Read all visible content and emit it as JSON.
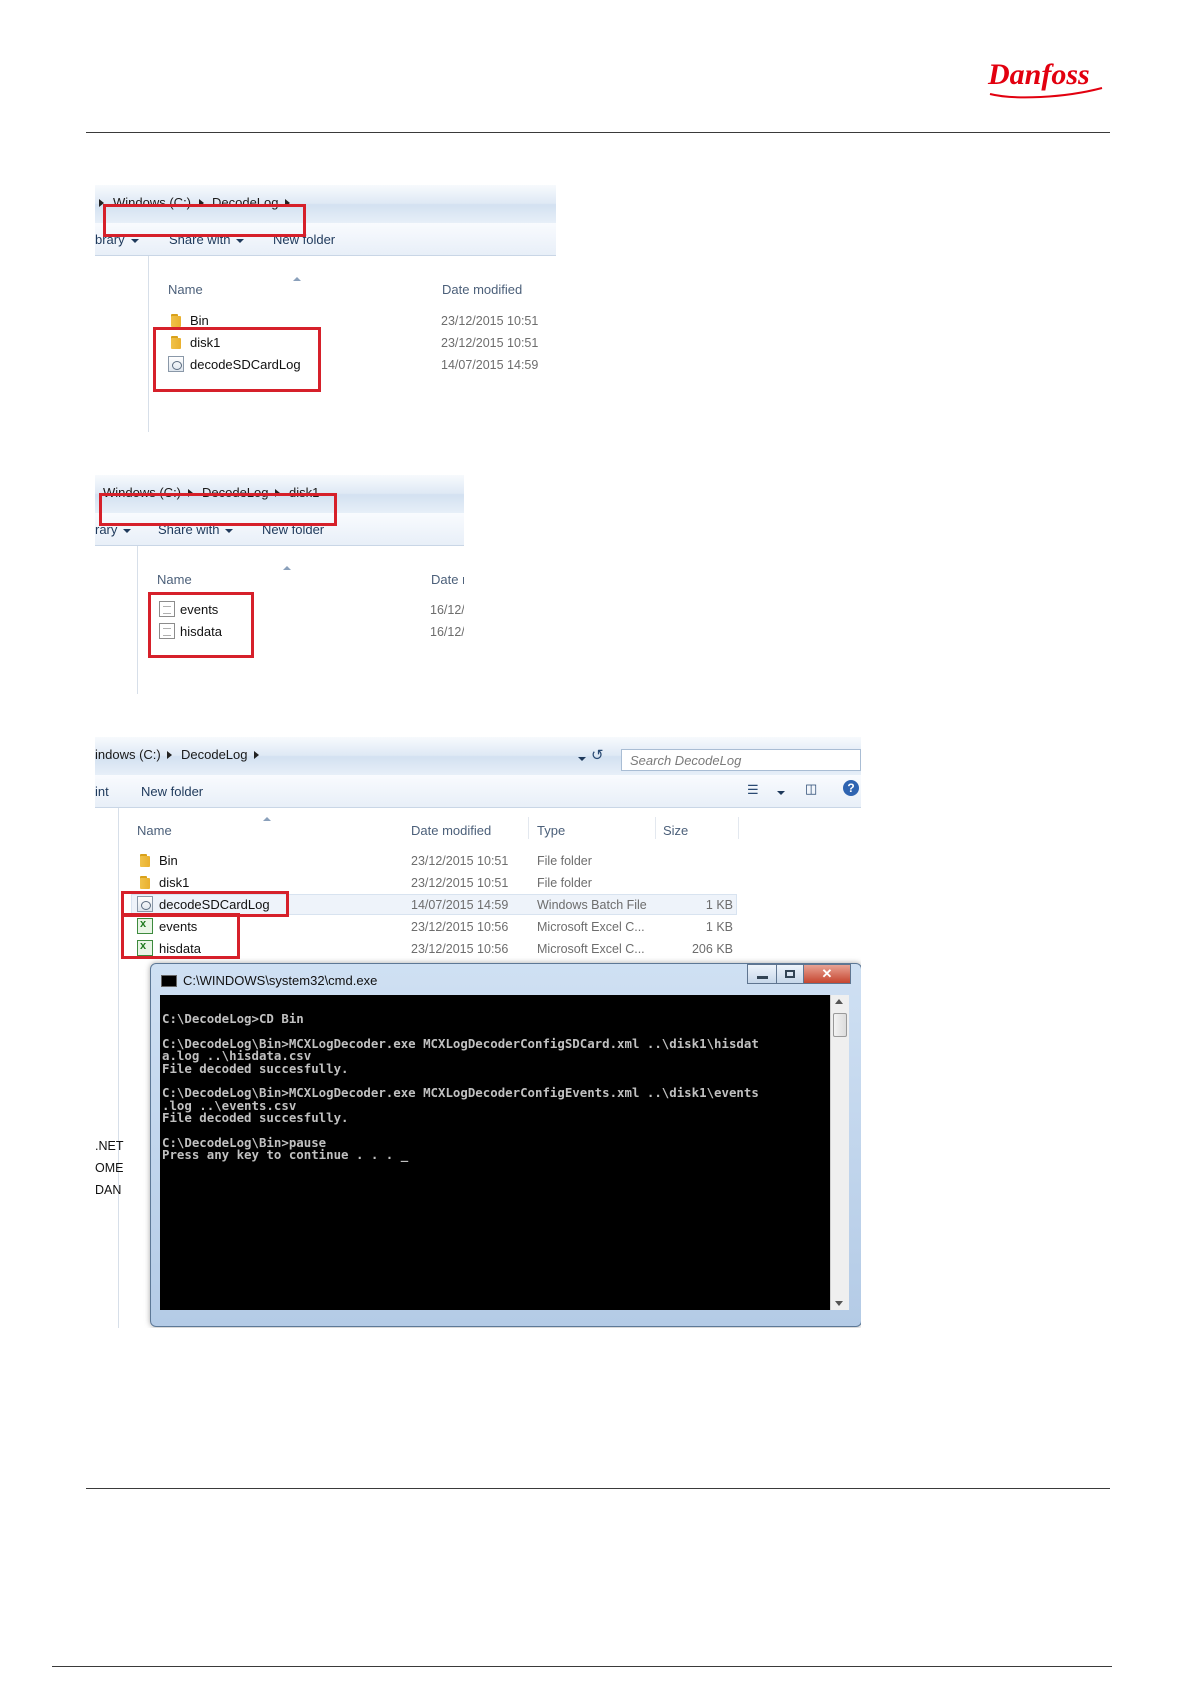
{
  "brand": {
    "logo_text": "Danfoss",
    "color": "#e2000f"
  },
  "screenshot1": {
    "breadcrumb": [
      "Windows (C:)",
      "DecodeLog"
    ],
    "toolbar": {
      "left_clip": "brary",
      "share": "Share with",
      "new_folder": "New folder"
    },
    "columns": {
      "name": "Name",
      "date": "Date modified"
    },
    "files": [
      {
        "name": "Bin",
        "date": "23/12/2015 10:51",
        "icon": "folder-icon"
      },
      {
        "name": "disk1",
        "date": "23/12/2015 10:51",
        "icon": "folder-icon"
      },
      {
        "name": "decodeSDCardLog",
        "date": "14/07/2015 14:59",
        "icon": "batch-file-icon"
      }
    ]
  },
  "screenshot2": {
    "breadcrumb": [
      "Windows (C:)",
      "DecodeLog",
      "disk1"
    ],
    "toolbar": {
      "left_clip": "rary",
      "share": "Share with",
      "new_folder": "New folder"
    },
    "columns": {
      "name": "Name",
      "date": "Date r"
    },
    "files": [
      {
        "name": "events",
        "date": "16/12/",
        "icon": "document-icon"
      },
      {
        "name": "hisdata",
        "date": "16/12/",
        "icon": "document-icon"
      }
    ]
  },
  "screenshot3": {
    "breadcrumb": [
      "indows (C:)",
      "DecodeLog"
    ],
    "search_placeholder": "Search DecodeLog",
    "toolbar": {
      "left_clip": "int",
      "new_folder": "New folder"
    },
    "columns": {
      "name": "Name",
      "date": "Date modified",
      "type": "Type",
      "size": "Size"
    },
    "files": [
      {
        "name": "Bin",
        "date": "23/12/2015 10:51",
        "type": "File folder",
        "size": "",
        "icon": "folder-icon"
      },
      {
        "name": "disk1",
        "date": "23/12/2015 10:51",
        "type": "File folder",
        "size": "",
        "icon": "folder-icon"
      },
      {
        "name": "decodeSDCardLog",
        "date": "14/07/2015 14:59",
        "type": "Windows Batch File",
        "size": "1 KB",
        "icon": "batch-file-icon"
      },
      {
        "name": "events",
        "date": "23/12/2015 10:56",
        "type": "Microsoft Excel C...",
        "size": "1 KB",
        "icon": "excel-csv-icon"
      },
      {
        "name": "hisdata",
        "date": "23/12/2015 10:56",
        "type": "Microsoft Excel C...",
        "size": "206 KB",
        "icon": "excel-csv-icon"
      }
    ],
    "nav_clips": [
      ".NET",
      "OME",
      "DAN"
    ]
  },
  "cmd": {
    "title": "C:\\WINDOWS\\system32\\cmd.exe",
    "icon_label": "C:\\.",
    "lines": [
      "C:\\DecodeLog>CD Bin",
      "",
      "C:\\DecodeLog\\Bin>MCXLogDecoder.exe MCXLogDecoderConfigSDCard.xml ..\\disk1\\hisdat",
      "a.log ..\\hisdata.csv",
      "File decoded succesfully.",
      "",
      "C:\\DecodeLog\\Bin>MCXLogDecoder.exe MCXLogDecoderConfigEvents.xml ..\\disk1\\events",
      ".log ..\\events.csv",
      "File decoded succesfully.",
      "",
      "C:\\DecodeLog\\Bin>pause",
      "Press any key to continue . . . _"
    ]
  }
}
